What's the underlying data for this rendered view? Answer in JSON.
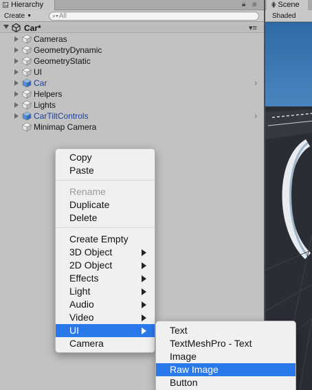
{
  "hierarchy": {
    "tab_title": "Hierarchy",
    "create_label": "Create",
    "search_placeholder": "All",
    "scene_name": "Car*",
    "items": [
      {
        "label": "Cameras",
        "selected_prefab": false
      },
      {
        "label": "GeometryDynamic",
        "selected_prefab": false
      },
      {
        "label": "GeometryStatic",
        "selected_prefab": false
      },
      {
        "label": "UI",
        "selected_prefab": false
      },
      {
        "label": "Car",
        "selected_prefab": true
      },
      {
        "label": "Helpers",
        "selected_prefab": false
      },
      {
        "label": "Lights",
        "selected_prefab": false
      },
      {
        "label": "CarTiltControls",
        "selected_prefab": true
      },
      {
        "label": "Minimap Camera",
        "selected_prefab": false
      }
    ]
  },
  "scene": {
    "tab_title": "Scene",
    "shading_mode": "Shaded"
  },
  "context_menu": {
    "items": [
      {
        "label": "Copy"
      },
      {
        "label": "Paste"
      },
      {
        "label": "Rename",
        "disabled": true
      },
      {
        "label": "Duplicate"
      },
      {
        "label": "Delete"
      },
      {
        "label": "Create Empty"
      },
      {
        "label": "3D Object",
        "submenu": true
      },
      {
        "label": "2D Object",
        "submenu": true
      },
      {
        "label": "Effects",
        "submenu": true
      },
      {
        "label": "Light",
        "submenu": true
      },
      {
        "label": "Audio",
        "submenu": true
      },
      {
        "label": "Video",
        "submenu": true
      },
      {
        "label": "UI",
        "submenu": true,
        "highlighted": true
      },
      {
        "label": "Camera"
      }
    ]
  },
  "ui_submenu": {
    "items": [
      {
        "label": "Text"
      },
      {
        "label": "TextMeshPro - Text"
      },
      {
        "label": "Image"
      },
      {
        "label": "Raw Image",
        "highlighted": true
      },
      {
        "label": "Button"
      }
    ]
  },
  "colors": {
    "highlight": "#2a79ea",
    "prefab_text": "#1c3f9a",
    "scene_sky": "#2d5a86"
  }
}
